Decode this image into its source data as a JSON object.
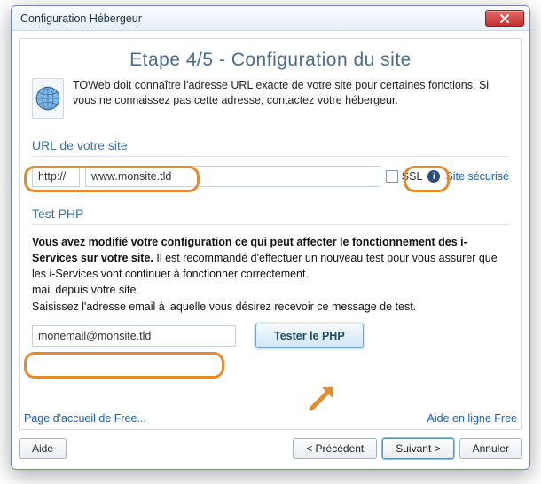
{
  "window": {
    "title": "Configuration Hébergeur"
  },
  "step": {
    "heading": "Etape 4/5 - Configuration du site"
  },
  "intro": {
    "text": "TOWeb doit connaître l'adresse URL exacte de votre site pour certaines fonctions. Si vous ne connaissez pas cette adresse, contactez votre hébergeur."
  },
  "url_section": {
    "label": "URL de votre site",
    "prefix": "http://",
    "value": "www.monsite.tld",
    "ssl_label": "SSL",
    "secure_link": "Site sécurisé"
  },
  "php_section": {
    "label": "Test PHP",
    "bold_line": "Vous avez modifié votre configuration ce qui peut affecter le fonctionnement des i-Services sur votre site.",
    "text_rest": " Il est recommandé d'effectuer un nouveau test pour vous assurer que les i-Services vont continuer à fonctionner correctement.",
    "mail_line": "mail depuis votre site.",
    "prompt": "Saisissez l'adresse email à laquelle vous désirez recevoir ce message de test.",
    "email_value": "monemail@monsite.tld",
    "test_button": "Tester le PHP"
  },
  "footer": {
    "left_link": "Page d'accueil de Free...",
    "right_link": "Aide en ligne Free"
  },
  "buttons": {
    "help": "Aide",
    "prev": "< Précédent",
    "next": "Suivant >",
    "cancel": "Annuler"
  }
}
